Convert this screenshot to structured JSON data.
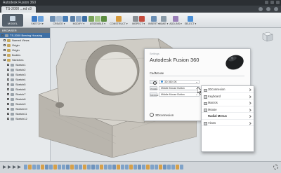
{
  "titlebar": {
    "title": "Autodesk Fusion 360"
  },
  "tab": {
    "label": "TS-2000 ...ed v3"
  },
  "ribbon": {
    "workspace_label": "MODEL",
    "tools": [
      {
        "label": "SKETCH",
        "colors": [
          "#3d7ac4",
          "#6ba2dc"
        ]
      },
      {
        "label": "CREATE",
        "colors": [
          "#6e8fb3",
          "#a8bdd4",
          "#4a7fb8"
        ]
      },
      {
        "label": "MODIFY",
        "colors": [
          "#5b7fa6",
          "#8da9c8",
          "#3d6fa5"
        ]
      },
      {
        "label": "ASSEMBLE",
        "colors": [
          "#7aa35b",
          "#a6c88a",
          "#5c8d41"
        ]
      },
      {
        "label": "CONSTRUCT",
        "colors": [
          "#d69a3d"
        ]
      },
      {
        "label": "INSPECT",
        "colors": [
          "#8a8f94",
          "#c44b3d"
        ]
      },
      {
        "label": "INSERT",
        "colors": [
          "#6b8fb5"
        ]
      },
      {
        "label": "MAKE",
        "colors": [
          "#8a9ba8"
        ]
      },
      {
        "label": "ADD-INS",
        "colors": [
          "#9a7fb8"
        ]
      },
      {
        "label": "SELECT",
        "colors": [
          "#4a8fd6"
        ]
      }
    ]
  },
  "browser": {
    "header": "BROWSER",
    "items": [
      {
        "label": "TS-2000 Bearing Housing",
        "kind": "root"
      },
      {
        "label": "Named Views",
        "kind": "folder"
      },
      {
        "label": "Origin",
        "kind": "folder"
      },
      {
        "label": "Origin",
        "kind": "folder"
      },
      {
        "label": "Bodies",
        "kind": "folder"
      },
      {
        "label": "Sketches",
        "kind": "folder"
      },
      {
        "label": "Sketch1",
        "kind": "item"
      },
      {
        "label": "Sketch2",
        "kind": "item"
      },
      {
        "label": "Sketch3",
        "kind": "item"
      },
      {
        "label": "Sketch4",
        "kind": "item"
      },
      {
        "label": "Sketch5",
        "kind": "item"
      },
      {
        "label": "Sketch6",
        "kind": "item"
      },
      {
        "label": "Sketch7",
        "kind": "item"
      },
      {
        "label": "Sketch8",
        "kind": "item"
      },
      {
        "label": "Sketch9",
        "kind": "item"
      },
      {
        "label": "Sketch10",
        "kind": "item"
      },
      {
        "label": "Sketch11",
        "kind": "item"
      },
      {
        "label": "Sketch12",
        "kind": "item"
      }
    ]
  },
  "dialog": {
    "settings_label": "Settings",
    "title": "Autodesk Fusion 360",
    "device_label": "CadMouse",
    "rows": [
      {
        "tag": "",
        "value": "3D 360 OK"
      },
      {
        "tag": "WHEEL",
        "value": "Middle Mouse Button"
      },
      {
        "tag": "MIDDLE",
        "value": "Middle Mouse Button"
      }
    ],
    "brand": "3Dconnexion"
  },
  "popup": {
    "items": [
      {
        "label": "3Dconnexion",
        "style": "folder"
      },
      {
        "label": "Keyboard",
        "style": "folder"
      },
      {
        "label": "Macros",
        "style": "folder"
      },
      {
        "label": "Mouse",
        "style": "folder"
      },
      {
        "label": "Radial Menus",
        "style": "bold"
      },
      {
        "label": "Views",
        "style": "folder"
      }
    ]
  },
  "timeline": {
    "colors": [
      "#7fa2c8",
      "#d6a04a",
      "#7fa2c8",
      "#7fa2c8",
      "#d6a04a",
      "#6e93bd",
      "#7fa2c8",
      "#d6a04a",
      "#7fa2c8",
      "#7fa2c8",
      "#6e93bd",
      "#d6a04a",
      "#7fa2c8",
      "#7fa2c8",
      "#d6a04a",
      "#7fa2c8",
      "#6e93bd",
      "#7fa2c8",
      "#d6a04a",
      "#7fa2c8",
      "#7fa2c8",
      "#6e93bd",
      "#d6a04a",
      "#7fa2c8",
      "#7fa2c8",
      "#d6a04a",
      "#7fa2c8",
      "#6e93bd",
      "#7fa2c8",
      "#d6a04a",
      "#7fa2c8",
      "#7fa2c8",
      "#d6a04a",
      "#6e93bd",
      "#7fa2c8",
      "#7fa2c8",
      "#d6a04a",
      "#7fa2c8"
    ]
  }
}
